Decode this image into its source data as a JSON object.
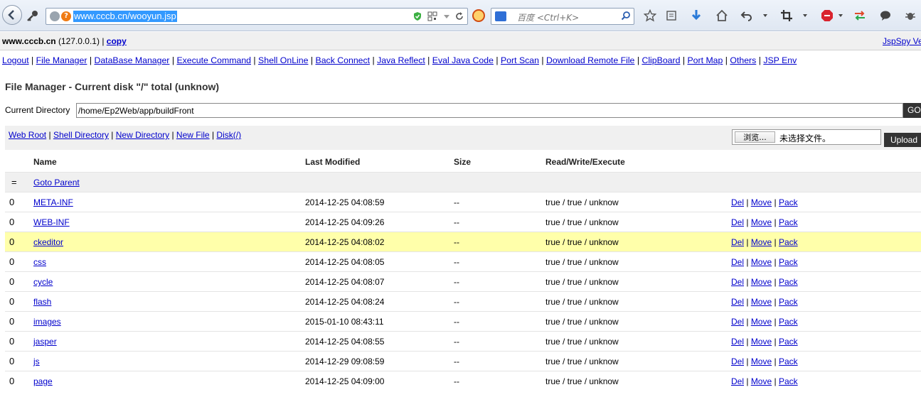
{
  "browser": {
    "url": "www.cccb.cn/wooyun.jsp",
    "search_placeholder": "百度 <Ctrl+K>"
  },
  "header": {
    "host": "www.cccb.cn",
    "ip": "(127.0.0.1)",
    "copy_label": "copy",
    "version": "JspSpy Ve"
  },
  "menu": [
    "Logout",
    "File Manager",
    "DataBase Manager",
    "Execute Command",
    "Shell OnLine",
    "Back Connect",
    "Java Reflect",
    "Eval Java Code",
    "Port Scan",
    "Download Remote File",
    "ClipBoard",
    "Port Map",
    "Others",
    "JSP Env"
  ],
  "page": {
    "title": "File Manager - Current disk \"/\" total (unknow)",
    "current_dir_label": "Current Directory",
    "current_dir_value": "/home/Ep2Web/app/buildFront",
    "go_label": "GO",
    "upload_label": "Upload",
    "browse_label": "浏览...",
    "no_file_label": "未选择文件。"
  },
  "quick_links": [
    "Web Root",
    "Shell Directory",
    "New Directory",
    "New File",
    "Disk(/)"
  ],
  "table": {
    "headers": {
      "name": "Name",
      "modified": "Last Modified",
      "size": "Size",
      "rwx": "Read/Write/Execute"
    },
    "parent": {
      "idx": "=",
      "name": "Goto Parent"
    },
    "actions": [
      "Del",
      "Move",
      "Pack"
    ],
    "rows": [
      {
        "idx": "0",
        "name": "META-INF",
        "modified": "2014-12-25 04:08:59",
        "size": "--",
        "rwx": "true / true / unknow"
      },
      {
        "idx": "0",
        "name": "WEB-INF",
        "modified": "2014-12-25 04:09:26",
        "size": "--",
        "rwx": "true / true / unknow"
      },
      {
        "idx": "0",
        "name": "ckeditor",
        "modified": "2014-12-25 04:08:02",
        "size": "--",
        "rwx": "true / true / unknow"
      },
      {
        "idx": "0",
        "name": "css",
        "modified": "2014-12-25 04:08:05",
        "size": "--",
        "rwx": "true / true / unknow"
      },
      {
        "idx": "0",
        "name": "cycle",
        "modified": "2014-12-25 04:08:07",
        "size": "--",
        "rwx": "true / true / unknow"
      },
      {
        "idx": "0",
        "name": "flash",
        "modified": "2014-12-25 04:08:24",
        "size": "--",
        "rwx": "true / true / unknow"
      },
      {
        "idx": "0",
        "name": "images",
        "modified": "2015-01-10 08:43:11",
        "size": "--",
        "rwx": "true / true / unknow"
      },
      {
        "idx": "0",
        "name": "jasper",
        "modified": "2014-12-25 04:08:55",
        "size": "--",
        "rwx": "true / true / unknow"
      },
      {
        "idx": "0",
        "name": "js",
        "modified": "2014-12-29 09:08:59",
        "size": "--",
        "rwx": "true / true / unknow"
      },
      {
        "idx": "0",
        "name": "page",
        "modified": "2014-12-25 04:09:00",
        "size": "--",
        "rwx": "true / true / unknow"
      }
    ],
    "highlighted_row": 2
  }
}
